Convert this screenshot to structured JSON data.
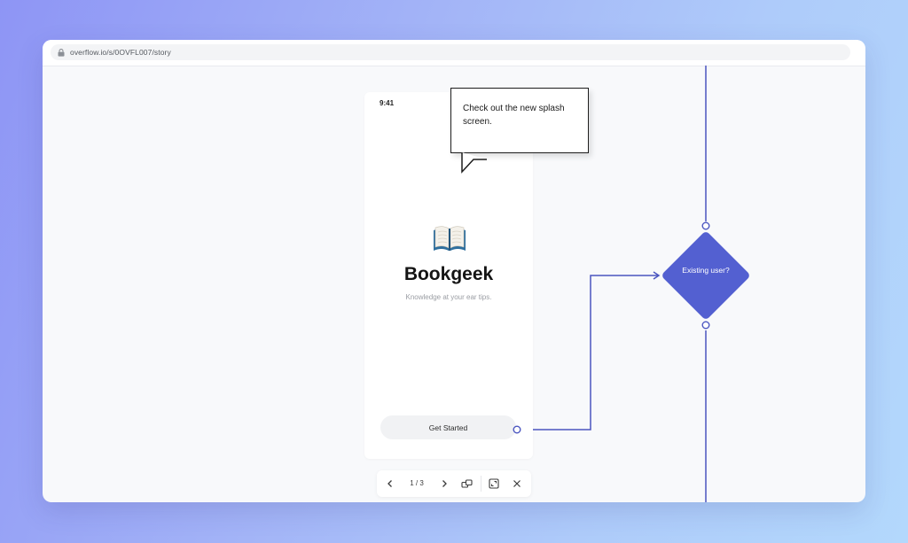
{
  "browser": {
    "url": "overflow.io/s/0OVFL007/story",
    "lock_icon": "lock-icon"
  },
  "phone": {
    "time": "9:41",
    "icon": "open-book-icon",
    "title": "Bookgeek",
    "tagline": "Knowledge at your ear tips.",
    "cta_label": "Get Started"
  },
  "callout": {
    "text": "Check out the new splash screen."
  },
  "flow": {
    "decision_label": "Existing user?",
    "accent_color": "#5360d1",
    "line_color": "#4a55c0"
  },
  "controls": {
    "page_current": 1,
    "page_total": 3,
    "page_label": "1 / 3",
    "icons": [
      "chevron-left-icon",
      "chevron-right-icon",
      "switch-screens-icon",
      "fullscreen-icon",
      "close-icon"
    ]
  }
}
